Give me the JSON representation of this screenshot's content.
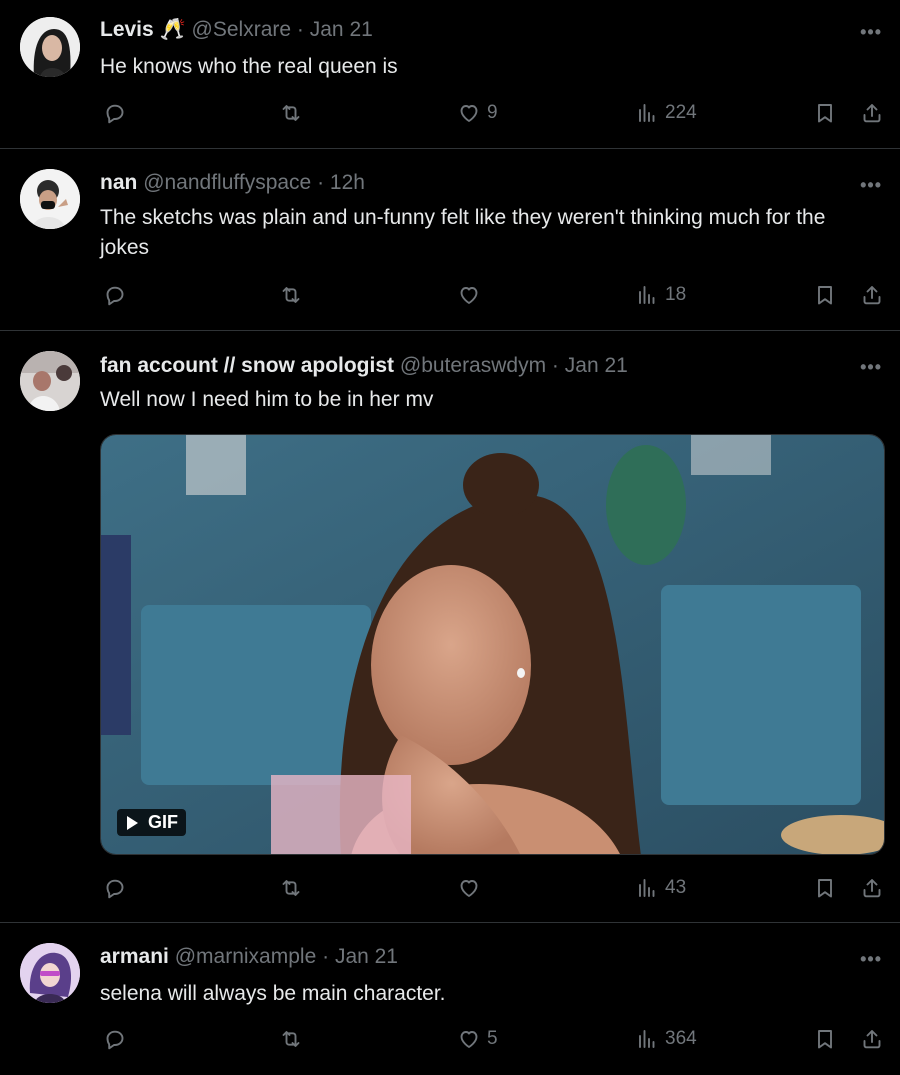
{
  "tweets": [
    {
      "name": "Levis",
      "name_emoji": "🥂",
      "handle": "@Selxrare",
      "time": "Jan 21",
      "text": "He knows who the real queen is",
      "likes": "9",
      "views": "224",
      "replies": "",
      "reposts": ""
    },
    {
      "name": "nan",
      "handle": "@nandfluffyspace",
      "time": "12h",
      "text": "The sketchs was plain and un-funny felt like they weren't  thinking much for the jokes",
      "likes": "",
      "views": "18",
      "replies": "",
      "reposts": ""
    },
    {
      "name": "fan account // snow apologist",
      "handle": "@buteraswdym",
      "time": "Jan 21",
      "text": "Well now I need him to be in her mv",
      "media_badge": "GIF",
      "likes": "",
      "views": "43",
      "replies": "",
      "reposts": ""
    },
    {
      "name": "armani",
      "handle": "@marnixample",
      "time": "Jan 21",
      "text": "selena will always be main character.",
      "likes": "5",
      "views": "364",
      "replies": "",
      "reposts": ""
    }
  ],
  "ui": {
    "more_label": "•••",
    "separator": "·"
  },
  "colors": {
    "background": "#000000",
    "text": "#e7e9ea",
    "muted": "#71767b",
    "divider": "#2f3336"
  },
  "icons": [
    "reply-icon",
    "repost-icon",
    "like-icon",
    "views-icon",
    "bookmark-icon",
    "share-icon",
    "more-icon",
    "play-icon"
  ]
}
